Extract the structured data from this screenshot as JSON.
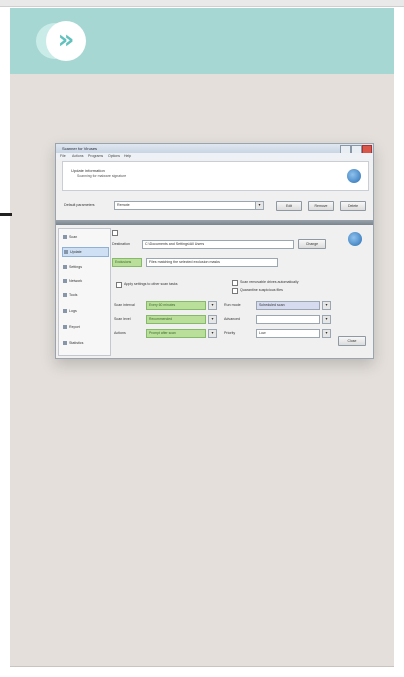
{
  "header": {
    "icon": "double-chevron-right-icon",
    "glyph": "»",
    "color": "#a6d7d3"
  },
  "window": {
    "title": "Scanner for Viruses",
    "menu": [
      "File",
      "Actions",
      "Programs",
      "Options",
      "Help"
    ],
    "info_title": "Update information",
    "info_sub": "Scanning for malware signature",
    "row_label": "Default parameters",
    "row_value": "Remote",
    "buttons": {
      "b1": "Edit",
      "b2": "Remove",
      "b3": "Delete",
      "close": "Close"
    },
    "sidebar": [
      "Scan",
      "Update",
      "Settings",
      "Network",
      "Tools",
      "Logs",
      "Report",
      "Statistics"
    ],
    "path_label": "Destination",
    "path_value": "C:\\Documents and Settings\\All Users",
    "path_button": "Change",
    "filter_label": "Exclusions",
    "filter_value": "Files matching the selected exclusion masks",
    "check1": "Apply settings to other scan tasks",
    "check2": "Scan removable drives automatically",
    "check3": "Quarantine suspicious files",
    "left_fields": [
      {
        "label": "Scan interval",
        "value": "Every 60 minutes"
      },
      {
        "label": "Scan level",
        "value": "Recommended"
      },
      {
        "label": "Actions",
        "value": "Prompt after scan"
      }
    ],
    "right_fields": [
      {
        "label": "Run mode",
        "value": "Scheduled scan"
      },
      {
        "label": "Advanced",
        "value": ""
      },
      {
        "label": "Priority",
        "value": "Low"
      }
    ]
  }
}
